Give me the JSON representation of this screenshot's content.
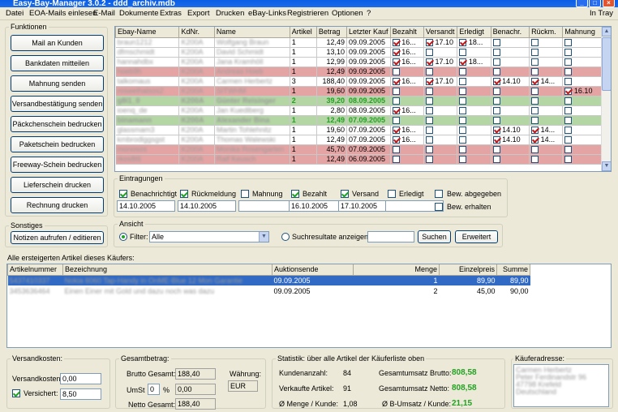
{
  "window": {
    "title": "Easy-Bay-Manager 3.0.2 - ddd_archiv.mdb",
    "minimize": "_",
    "maximize": "□",
    "close": "×"
  },
  "menu": {
    "items": [
      "Datei",
      "EOA-Mails einlesen",
      "E-Mail",
      "Dokumente",
      "Extras",
      "Export",
      "Drucken",
      "eBay-Links",
      "Registrieren",
      "Optionen",
      "?"
    ],
    "tray": "In Tray"
  },
  "funktionen": {
    "title": "Funktionen",
    "buttons": [
      "Mail an Kunden",
      "Bankdaten mitteilen",
      "Mahnung senden",
      "Versandbestätigung senden",
      "Päckchenschein bedrucken",
      "Paketschein bedrucken",
      "Freeway-Schein bedrucken",
      "Lieferschein drucken",
      "Rechnung drucken"
    ]
  },
  "sonstiges": {
    "title": "Sonstiges",
    "button": "Notizen aufrufen / editieren"
  },
  "grid": {
    "columns": [
      "Ebay-Name",
      "KdNr.",
      "Name",
      "Artikel",
      "Betrag",
      "Letzter Kauf",
      "Bezahlt",
      "Versandt",
      "Erledigt",
      "Benachr.",
      "Rückm.",
      "Mahnung"
    ],
    "rows": [
      {
        "ebay": "braun1212",
        "kdnr": "K200A",
        "name": "Wolfgang Braun",
        "artikel": "1",
        "betrag": "12,49",
        "kauf": "09.09.2005",
        "bez": true,
        "bez_t": "16...",
        "ver": true,
        "ver_t": "17.10",
        "erl": true,
        "erl_t": "18...",
        "ben": false,
        "ben_t": "",
        "rue": false,
        "rue_t": "",
        "mah": false,
        "mah_t": "",
        "style": ""
      },
      {
        "ebay": "dfmschmidt",
        "kdnr": "K200A",
        "name": "David Schmidt",
        "artikel": "1",
        "betrag": "13,10",
        "kauf": "09.09.2005",
        "bez": true,
        "bez_t": "16...",
        "ver": false,
        "ver_t": "",
        "erl": false,
        "erl_t": "",
        "ben": false,
        "ben_t": "",
        "rue": false,
        "rue_t": "",
        "mah": false,
        "mah_t": "",
        "style": ""
      },
      {
        "ebay": "hannahdbx",
        "kdnr": "K200A",
        "name": "Jana Kramhöll",
        "artikel": "1",
        "betrag": "12,99",
        "kauf": "09.09.2005",
        "bez": true,
        "bez_t": "16...",
        "ver": true,
        "ver_t": "17.10",
        "erl": true,
        "erl_t": "18...",
        "ben": false,
        "ben_t": "",
        "rue": false,
        "rue_t": "",
        "mah": false,
        "mah_t": "",
        "style": ""
      },
      {
        "ebay": "hoeb9h",
        "kdnr": "K200A",
        "name": "Andreas Hoeb",
        "artikel": "1",
        "betrag": "12,49",
        "kauf": "09.09.2005",
        "bez": false,
        "bez_t": "",
        "ver": false,
        "ver_t": "",
        "erl": false,
        "erl_t": "",
        "ben": false,
        "ben_t": "",
        "rue": false,
        "rue_t": "",
        "mah": false,
        "mah_t": "",
        "style": "red"
      },
      {
        "ebay": "talkomaus",
        "kdnr": "K200A",
        "name": "Carmen Herbertz",
        "artikel": "3",
        "betrag": "188,40",
        "kauf": "09.09.2005",
        "bez": true,
        "bez_t": "16...",
        "ver": true,
        "ver_t": "17.10",
        "erl": false,
        "erl_t": "",
        "ben": true,
        "ben_t": "14.10",
        "rue": true,
        "rue_t": "14...",
        "mah": false,
        "mah_t": "",
        "style": ""
      },
      {
        "ebay": "roswelhalsos2",
        "kdnr": "K200A",
        "name": "SITWHM",
        "artikel": "1",
        "betrag": "19,60",
        "kauf": "09.09.2005",
        "bez": false,
        "bez_t": "",
        "ver": false,
        "ver_t": "",
        "erl": false,
        "erl_t": "",
        "ben": false,
        "ben_t": "",
        "rue": false,
        "rue_t": "",
        "mah": true,
        "mah_t": "16.10",
        "style": "red"
      },
      {
        "ebay": "g8l1_0",
        "kdnr": "K200A",
        "name": "Günter Reisinger",
        "artikel": "2",
        "betrag": "39,20",
        "kauf": "08.09.2005",
        "bez": false,
        "bez_t": "",
        "ver": false,
        "ver_t": "",
        "erl": false,
        "erl_t": "",
        "ben": false,
        "ben_t": "",
        "rue": false,
        "rue_t": "",
        "mah": false,
        "mah_t": "",
        "style": "green"
      },
      {
        "ebay": "ioenq_de",
        "kdnr": "K200A",
        "name": "Jan Kuedlberg",
        "artikel": "1",
        "betrag": "2,80",
        "kauf": "08.09.2005",
        "bez": true,
        "bez_t": "16...",
        "ver": false,
        "ver_t": "",
        "erl": false,
        "erl_t": "",
        "ben": false,
        "ben_t": "",
        "rue": false,
        "rue_t": "",
        "mah": false,
        "mah_t": "",
        "style": ""
      },
      {
        "ebay": "binamann",
        "kdnr": "K200A",
        "name": "Alexander Bina",
        "artikel": "1",
        "betrag": "12,49",
        "kauf": "07.09.2005",
        "bez": false,
        "bez_t": "",
        "ver": false,
        "ver_t": "",
        "erl": false,
        "erl_t": "",
        "ben": false,
        "ben_t": "",
        "rue": false,
        "rue_t": "",
        "mah": false,
        "mah_t": "",
        "style": "green"
      },
      {
        "ebay": "glassmam3",
        "kdnr": "K200A",
        "name": "Martin Tohlehnitz",
        "artikel": "1",
        "betrag": "19,60",
        "kauf": "07.09.2005",
        "bez": true,
        "bez_t": "16...",
        "ver": false,
        "ver_t": "",
        "erl": false,
        "erl_t": "",
        "ben": true,
        "ben_t": "14.10",
        "rue": true,
        "rue_t": "14...",
        "mah": false,
        "mah_t": "",
        "style": ""
      },
      {
        "ebay": "kmbrodlggsgst",
        "kdnr": "K200A",
        "name": "Thomas Walewski",
        "artikel": "1",
        "betrag": "12,49",
        "kauf": "07.09.2005",
        "bez": true,
        "bez_t": "16...",
        "ver": false,
        "ver_t": "",
        "erl": false,
        "erl_t": "",
        "ben": true,
        "ben_t": "14.10",
        "rue": true,
        "rue_t": "14...",
        "mah": false,
        "mah_t": "",
        "style": ""
      },
      {
        "ebay": "monosos",
        "kdnr": "K200A",
        "name": "Monika Rosengarten",
        "artikel": "1",
        "betrag": "45,70",
        "kauf": "07.09.2005",
        "bez": false,
        "bez_t": "",
        "ver": false,
        "ver_t": "",
        "erl": false,
        "erl_t": "",
        "ben": false,
        "ben_t": "",
        "rue": false,
        "rue_t": "",
        "mah": false,
        "mah_t": "",
        "style": "red"
      },
      {
        "ebay": "rkos8t6",
        "kdnr": "K200A",
        "name": "Ralf Keusch",
        "artikel": "1",
        "betrag": "12,49",
        "kauf": "06.09.2005",
        "bez": false,
        "bez_t": "",
        "ver": false,
        "ver_t": "",
        "erl": false,
        "erl_t": "",
        "ben": false,
        "ben_t": "",
        "rue": false,
        "rue_t": "",
        "mah": false,
        "mah_t": "",
        "style": "red"
      }
    ]
  },
  "eintragungen": {
    "title": "Eintragungen",
    "items": [
      {
        "label": "Benachrichtigt",
        "checked": true,
        "value": "14.10.2005"
      },
      {
        "label": "Rückmeldung",
        "checked": true,
        "value": "14.10.2005"
      },
      {
        "label": "Mahnung",
        "checked": false,
        "value": ""
      },
      {
        "label": "Bezahlt",
        "checked": true,
        "value": "16.10.2005"
      },
      {
        "label": "Versand",
        "checked": true,
        "value": "17.10.2005"
      },
      {
        "label": "Erledigt",
        "checked": false,
        "value": ""
      }
    ],
    "bew_abgegeben": "Bew. abgegeben",
    "bew_erhalten": "Bew. erhalten"
  },
  "ansicht": {
    "title": "Ansicht",
    "filter_label": "Filter:",
    "filter_value": "Alle",
    "search_label": "Suchresultate anzeigen",
    "search_value": "",
    "search_button": "Suchen",
    "extended_button": "Erweitert"
  },
  "articles": {
    "title": "Alle ersteigerten Artikel dieses Käufers:",
    "columns": [
      "Artikelnummer",
      "Bezeichnung",
      "Auktionsende",
      "Menge",
      "Einzelpreis",
      "Summe"
    ],
    "rows": [
      {
        "nr": "5437410337",
        "bez": "Nokia 6060 Tap-Handy in OnME-Blue 12 Mon Garantie",
        "ende": "09.09.2005",
        "menge": "1",
        "preis": "89,90",
        "summe": "89,90",
        "selected": true
      },
      {
        "nr": "3453636464",
        "bez": "Einen Einer mit Gold und dazu noch was dazu",
        "ende": "09.09.2005",
        "menge": "2",
        "preis": "45,00",
        "summe": "90,00",
        "selected": false
      }
    ]
  },
  "versand": {
    "title": "Versandkosten:",
    "versandkosten_label": "Versandkosten:",
    "versandkosten_value": "0,00",
    "versichert_label": "Versichert:",
    "versichert_checked": true,
    "versichert_value": "8,50"
  },
  "gesamt": {
    "title": "Gesamtbetrag:",
    "brutto_label": "Brutto Gesamt:",
    "brutto_value": "188,40",
    "ust_label": "UmSt",
    "ust_value": "0",
    "percent": "%",
    "ust_amount": "0,00",
    "netto_label": "Netto Gesamt:",
    "netto_value": "188,40",
    "waehrung_label": "Währung:",
    "waehrung_value": "EUR"
  },
  "statistik": {
    "title": "Statistik: über alle Artikel der Käuferliste oben",
    "kunden_label": "Kundenanzahl:",
    "kunden_value": "84",
    "verkauft_label": "Verkaufte Artikel:",
    "verkauft_value": "91",
    "menge_label": "Ø Menge / Kunde:",
    "menge_value": "1,08",
    "brutto_label": "Gesamtumsatz Brutto:",
    "brutto_value": "808,58",
    "netto_label": "Gesamtumsatz Netto:",
    "netto_value": "808,58",
    "bumsatz_label": "Ø B-Umsatz / Kunde:",
    "bumsatz_value": "21,15"
  },
  "kaeufer": {
    "title": "Käuferadresse:",
    "lines": [
      "Carmen Herbertz",
      "Peter Ferdinandstr 96",
      "47798 Krefeld",
      "Deutschland"
    ]
  }
}
